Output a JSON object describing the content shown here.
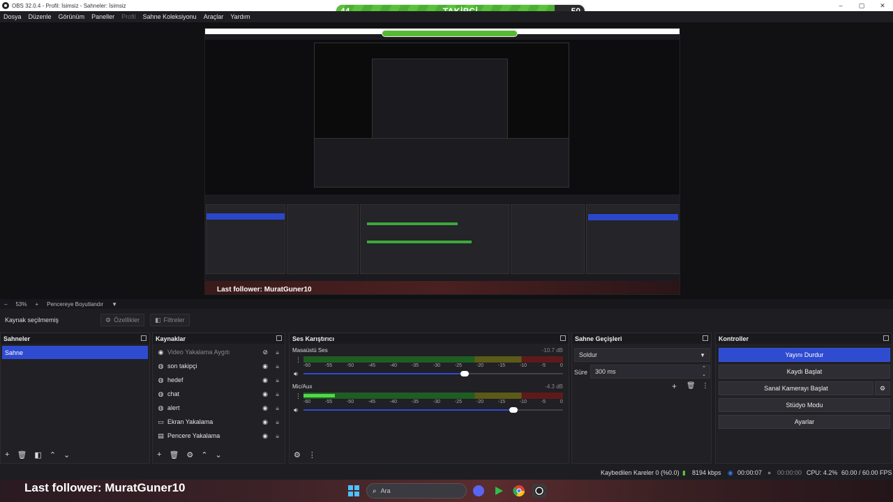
{
  "window": {
    "title": "OBS 32.0.4 - Profil: İsimsiz - Sahneler: İsimsiz",
    "controls": [
      "–",
      "▢",
      "✕"
    ]
  },
  "follower_widget": {
    "current": "44",
    "label": "TAKİPÇİ",
    "goal": "50",
    "progress_fraction": 0.88,
    "fill_color": "#58c23a"
  },
  "menu": {
    "items": [
      "Dosya",
      "Düzenle",
      "Görünüm",
      "Paneller",
      "Profil",
      "Sahne Koleksiyonu",
      "Araçlar",
      "Yardım"
    ],
    "disabled_index": 4
  },
  "preview": {
    "last_follower_text": "Last follower: MuratGuner10"
  },
  "zoombar": {
    "minus": "–",
    "zoom": "53%",
    "plus": "+",
    "fit_label": "Pencereye Boyutlandır",
    "dropdown_icon": "chevron-down-icon"
  },
  "toolbar": {
    "no_source": "Kaynak seçilmemiş",
    "properties_label": "Özellikler",
    "filters_label": "Filtreler"
  },
  "scenes": {
    "title": "Sahneler",
    "items": [
      "Sahne"
    ]
  },
  "sources": {
    "title": "Kaynaklar",
    "items": [
      {
        "label": "Video Yakalama Aygıtı",
        "icon": "camera-icon",
        "hidden": true
      },
      {
        "label": "son takipçi",
        "icon": "globe-icon",
        "hidden": false
      },
      {
        "label": "hedef",
        "icon": "globe-icon",
        "hidden": false
      },
      {
        "label": "chat",
        "icon": "globe-icon",
        "hidden": false
      },
      {
        "label": "alert",
        "icon": "globe-icon",
        "hidden": false
      },
      {
        "label": "Ekran Yakalama",
        "icon": "monitor-icon",
        "hidden": false
      },
      {
        "label": "Pencere Yakalama",
        "icon": "window-icon",
        "hidden": false
      }
    ]
  },
  "mixer": {
    "title": "Ses Karıştırıcı",
    "ticks": [
      "-60",
      "-55",
      "-50",
      "-45",
      "-40",
      "-35",
      "-30",
      "-25",
      "-20",
      "-15",
      "-10",
      "-5",
      "0"
    ],
    "channels": [
      {
        "name": "Masaüstü Ses",
        "db": "-10.7 dB",
        "volume_fraction": 0.62,
        "level_fraction": 0.0
      },
      {
        "name": "Mic/Aux",
        "db": "-4.3 dB",
        "volume_fraction": 0.81,
        "level_fraction": 0.12
      }
    ]
  },
  "transitions": {
    "title": "Sahne Geçişleri",
    "selected": "Soldur",
    "duration_label": "Süre",
    "duration_value": "300 ms"
  },
  "controls": {
    "title": "Kontroller",
    "stop_stream": "Yayını Durdur",
    "start_recording": "Kaydı Başlat",
    "start_virtual_cam": "Sanal Kamerayı Başlat",
    "studio_mode": "Stüdyo Modu",
    "settings": "Ayarlar"
  },
  "status": {
    "dropped_frames": "Kaybedilen Kareler 0 (%0.0)",
    "bitrate": "8194 kbps",
    "stream_time": "00:00:07",
    "record_time": "00:00:00",
    "cpu": "CPU: 4.2%",
    "fps": "60.00 / 60.00 FPS"
  },
  "taskbar": {
    "last_follower": "Last follower: MuratGuner10",
    "search_placeholder": "Ara"
  },
  "colors": {
    "accent": "#2f4bd0",
    "background": "#1e1e22"
  }
}
